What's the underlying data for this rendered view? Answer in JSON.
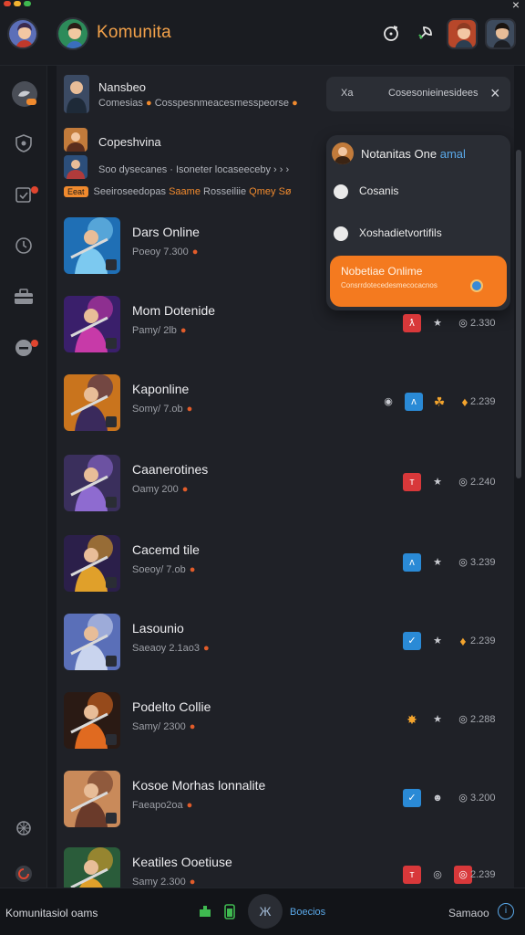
{
  "app": {
    "title": "Komunita"
  },
  "colors": {
    "accent": "#f47a1f",
    "red": "#d8383a",
    "blue": "#2a8ad6",
    "bg": "#16181d"
  },
  "topbar_icons": [
    "refresh-icon",
    "leaf-icon"
  ],
  "sidebar_icons": [
    "avatar-icon",
    "shield-icon",
    "checklist-icon",
    "clock-icon",
    "toolbox-icon",
    "chat-icon",
    "settings-icon",
    "logout-icon"
  ],
  "header": {
    "row1_title": "Nansbeo",
    "row1_sub": "Comesias",
    "row1_sub_rest": "Cosspesnmeacesmesspeorse",
    "row2_title": "Copeshvina",
    "row2_sub": "Soo dysecanes · Isoneter locaseeceby",
    "row2_tag": "Eeat",
    "row2_sub2_a": "Seeiroseedopas",
    "row2_sub2_b": "Saame",
    "row2_sub2_c": "Rosseiliie",
    "row2_sub2_d": "Qmey",
    "row2_sub2_e": "Sø"
  },
  "search": {
    "left_text": "Xa",
    "right_text": "Cosesonieinesidees"
  },
  "dropdown": {
    "header": "Notanitas One",
    "header_accent": "amal",
    "items": [
      "Cosanis",
      "Xoshadietvortifils"
    ],
    "active_title": "Nobetiae Onlime",
    "active_sub": "Consrrdotecedesmecocacnos"
  },
  "games": [
    {
      "name": "Dars Online",
      "sub": "Poeoy 7.300",
      "count": ""
    },
    {
      "name": "Mom Dotenide",
      "sub": "Pamy/ 2lb",
      "count": "2.330"
    },
    {
      "name": "Kaponline",
      "sub": "Somy/ 7.ob",
      "count": "2.239"
    },
    {
      "name": "Caanerotines",
      "sub": "Oamy 200",
      "count": "2.240"
    },
    {
      "name": "Cacemd tile",
      "sub": "Soeoy/ 7.ob",
      "count": "3.239"
    },
    {
      "name": "Lasounio",
      "sub": "Saeaoy 2.1ao3",
      "count": "2.239"
    },
    {
      "name": "Podelto Collie",
      "sub": "Samy/ 2300",
      "count": "2.288"
    },
    {
      "name": "Kosoe Morhas lonnalite",
      "sub": "Faeapo2oa",
      "count": "3.200"
    },
    {
      "name": "Keatiles Ooetiuse",
      "sub": "Samy 2.300",
      "count": "2.239"
    }
  ],
  "bottom": {
    "left": "Komunitasiol oams",
    "mid": "Boecios",
    "right": "Samaoo"
  }
}
